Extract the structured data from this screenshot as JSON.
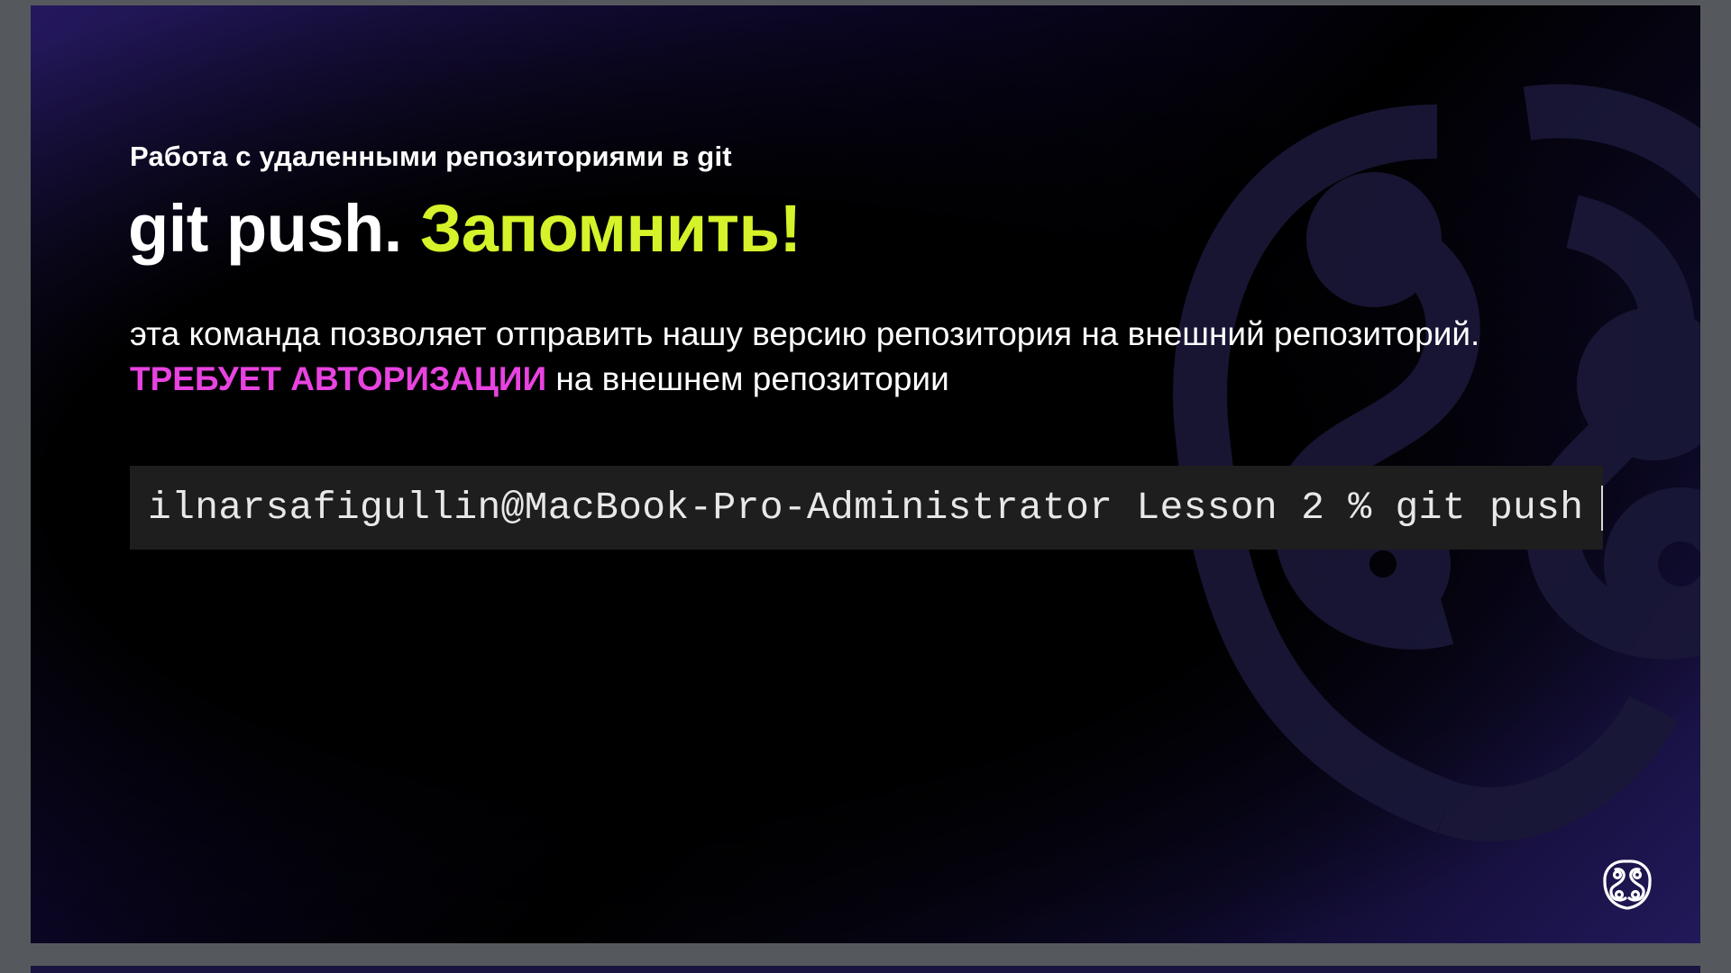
{
  "slide": {
    "subtitle": "Работа с удаленными репозиториями в git",
    "title_main": "git push. ",
    "title_accent": "Запомнить!",
    "description": {
      "part1": "эта команда позволяет отправить нашу версию репозитория на внешний репозиторий. ",
      "highlight": "ТРЕБУЕТ АВТОРИЗАЦИИ",
      "part2": " на внешнем репозитории"
    },
    "terminal": {
      "command": "ilnarsafigullin@MacBook-Pro-Administrator Lesson 2 % git push"
    }
  },
  "icons": {
    "watermark": "brain-logo-watermark-icon",
    "logo": "brain-logo-icon"
  },
  "colors": {
    "accent_lime": "#d6f22a",
    "accent_magenta": "#e843e0",
    "terminal_bg": "#1e1e1e",
    "slide_bg": "#000000",
    "viewer_bg": "#55595d"
  }
}
